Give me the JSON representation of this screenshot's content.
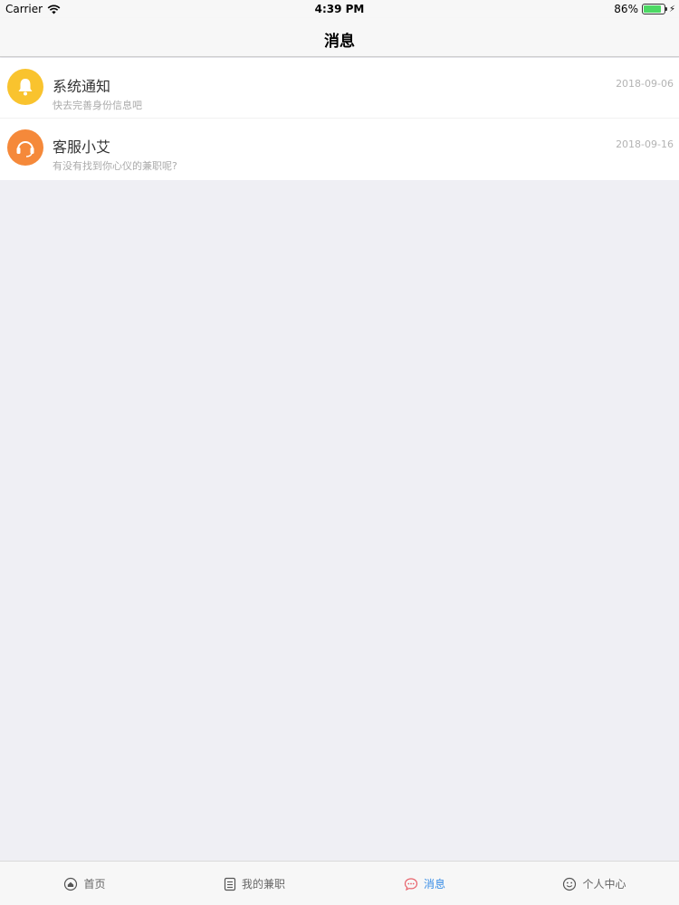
{
  "status_bar": {
    "carrier": "Carrier",
    "time": "4:39 PM",
    "battery_percent": "86%",
    "battery_level": 0.86
  },
  "nav": {
    "title": "消息"
  },
  "messages": [
    {
      "title": "系统通知",
      "subtitle": "快去完善身份信息吧",
      "date": "2018-09-06",
      "icon": "bell-icon",
      "color": "#f9c32e"
    },
    {
      "title": "客服小艾",
      "subtitle": "有没有找到你心仪的兼职呢?",
      "date": "2018-09-16",
      "icon": "headset-icon",
      "color": "#f5893a"
    }
  ],
  "tabs": [
    {
      "label": "首页",
      "icon": "home-icon",
      "active": false
    },
    {
      "label": "我的兼职",
      "icon": "document-icon",
      "active": false
    },
    {
      "label": "消息",
      "icon": "chat-bubble-icon",
      "active": true
    },
    {
      "label": "个人中心",
      "icon": "smiley-icon",
      "active": false
    }
  ],
  "colors": {
    "active_tab": "#3a8ee6",
    "background": "#efeff4"
  }
}
